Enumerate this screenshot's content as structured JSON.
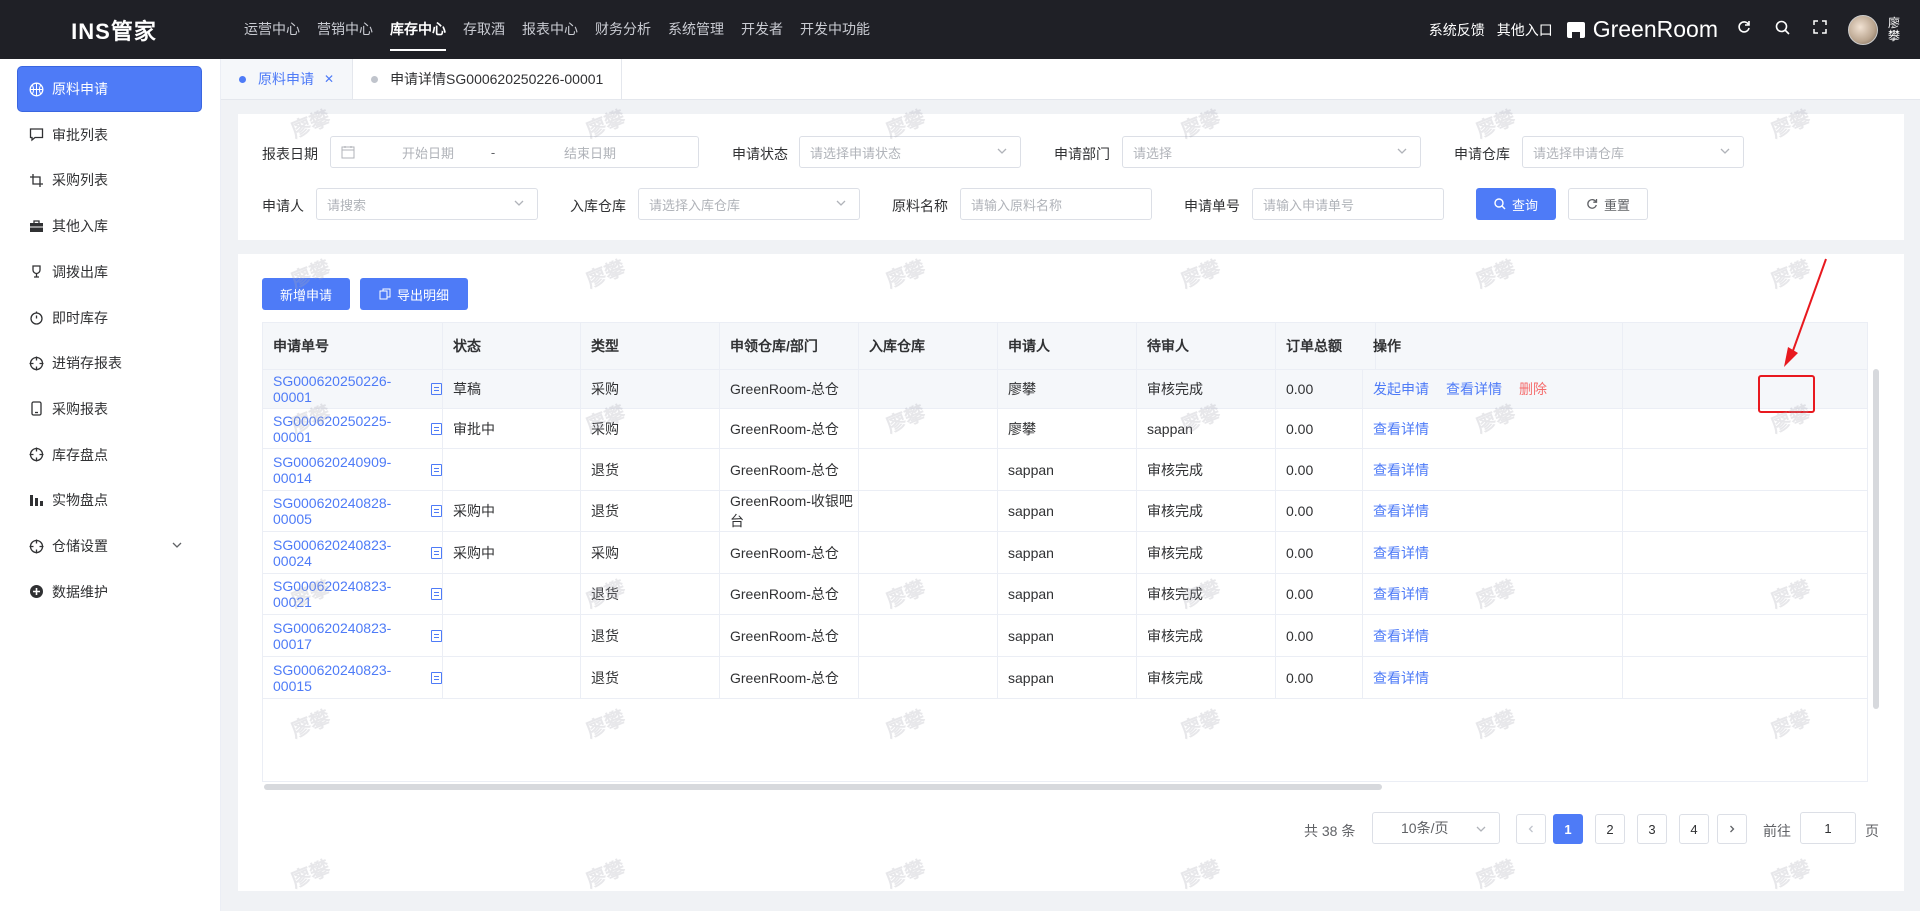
{
  "app": {
    "logo": "INS管家",
    "store_name": "GreenRoom",
    "user_name": "廖攀"
  },
  "topnav": [
    "运营中心",
    "营销中心",
    "库存中心",
    "存取酒",
    "报表中心",
    "财务分析",
    "系统管理",
    "开发者",
    "开发中功能"
  ],
  "topnav_active": "库存中心",
  "topright": {
    "feedback": "系统反馈",
    "other_entry": "其他入口"
  },
  "sidebar": [
    {
      "label": "原料申请",
      "icon": "basketball-icon",
      "active": true
    },
    {
      "label": "审批列表",
      "icon": "comment-icon"
    },
    {
      "label": "采购列表",
      "icon": "crop-icon"
    },
    {
      "label": "其他入库",
      "icon": "briefcase-icon"
    },
    {
      "label": "调拨出库",
      "icon": "trophy-icon"
    },
    {
      "label": "即时库存",
      "icon": "timer-icon"
    },
    {
      "label": "进销存报表",
      "icon": "target-icon"
    },
    {
      "label": "采购报表",
      "icon": "mobile-icon"
    },
    {
      "label": "库存盘点",
      "icon": "target-icon"
    },
    {
      "label": "实物盘点",
      "icon": "histogram-icon"
    },
    {
      "label": "仓储设置",
      "icon": "target-icon",
      "has_children": true
    },
    {
      "label": "数据维护",
      "icon": "plus-circle-icon"
    }
  ],
  "tabs": [
    {
      "label": "原料申请",
      "active": true,
      "closable": true
    },
    {
      "label": "申请详情SG000620250226-00001",
      "active": false
    }
  ],
  "filters": {
    "report_date_label": "报表日期",
    "start_date_placeholder": "开始日期",
    "date_separator": "-",
    "end_date_placeholder": "结束日期",
    "status_label": "申请状态",
    "status_placeholder": "请选择申请状态",
    "dept_label": "申请部门",
    "dept_placeholder": "请选择",
    "warehouse_label": "申请仓库",
    "warehouse_placeholder": "请选择申请仓库",
    "applicant_label": "申请人",
    "applicant_placeholder": "请搜索",
    "in_warehouse_label": "入库仓库",
    "in_warehouse_placeholder": "请选择入库仓库",
    "material_label": "原料名称",
    "material_placeholder": "请输入原料名称",
    "order_no_label": "申请单号",
    "order_no_placeholder": "请输入申请单号",
    "query_btn": "查询",
    "reset_btn": "重置"
  },
  "actions": {
    "add": "新增申请",
    "export": "导出明细"
  },
  "table": {
    "columns": [
      "申请单号",
      "状态",
      "类型",
      "申领仓库/部门",
      "入库仓库",
      "申请人",
      "待审人",
      "订单总额",
      "操作"
    ],
    "rows": [
      {
        "no": "SG000620250226-00001",
        "status": "草稿",
        "type": "采购",
        "warehouse": "GreenRoom-总仓",
        "in_wh": "",
        "applicant": "廖攀",
        "reviewer": "审核完成",
        "total": "0.00",
        "ops": [
          "发起申请",
          "查看详情",
          "删除"
        ]
      },
      {
        "no": "SG000620250225-00001",
        "status": "审批中",
        "type": "采购",
        "warehouse": "GreenRoom-总仓",
        "in_wh": "",
        "applicant": "廖攀",
        "reviewer": "sappan",
        "total": "0.00",
        "ops": [
          "查看详情"
        ]
      },
      {
        "no": "SG000620240909-00014",
        "status": "",
        "type": "退货",
        "warehouse": "GreenRoom-总仓",
        "in_wh": "",
        "applicant": "sappan",
        "reviewer": "审核完成",
        "total": "0.00",
        "ops": [
          "查看详情"
        ]
      },
      {
        "no": "SG000620240828-00005",
        "status": "采购中",
        "type": "退货",
        "warehouse": "GreenRoom-收银吧台",
        "in_wh": "",
        "applicant": "sappan",
        "reviewer": "审核完成",
        "total": "0.00",
        "ops": [
          "查看详情"
        ]
      },
      {
        "no": "SG000620240823-00024",
        "status": "采购中",
        "type": "采购",
        "warehouse": "GreenRoom-总仓",
        "in_wh": "",
        "applicant": "sappan",
        "reviewer": "审核完成",
        "total": "0.00",
        "ops": [
          "查看详情"
        ]
      },
      {
        "no": "SG000620240823-00021",
        "status": "",
        "type": "退货",
        "warehouse": "GreenRoom-总仓",
        "in_wh": "",
        "applicant": "sappan",
        "reviewer": "审核完成",
        "total": "0.00",
        "ops": [
          "查看详情"
        ]
      },
      {
        "no": "SG000620240823-00017",
        "status": "",
        "type": "退货",
        "warehouse": "GreenRoom-总仓",
        "in_wh": "",
        "applicant": "sappan",
        "reviewer": "审核完成",
        "total": "0.00",
        "ops": [
          "查看详情"
        ]
      },
      {
        "no": "SG000620240823-00015",
        "status": "",
        "type": "退货",
        "warehouse": "GreenRoom-总仓",
        "in_wh": "",
        "applicant": "sappan",
        "reviewer": "审核完成",
        "total": "0.00",
        "ops": [
          "查看详情"
        ]
      }
    ]
  },
  "pagination": {
    "total_text": "共 38 条",
    "page_size": "10条/页",
    "pages": [
      "1",
      "2",
      "3",
      "4"
    ],
    "current": "1",
    "goto_label": "前往",
    "goto_value": "1",
    "goto_suffix": "页"
  },
  "watermark": "廖攀",
  "colors": {
    "primary": "#4e7bf7",
    "danger": "#f56c6c",
    "topbar": "#1f2026",
    "annotation": "#e8191f"
  }
}
